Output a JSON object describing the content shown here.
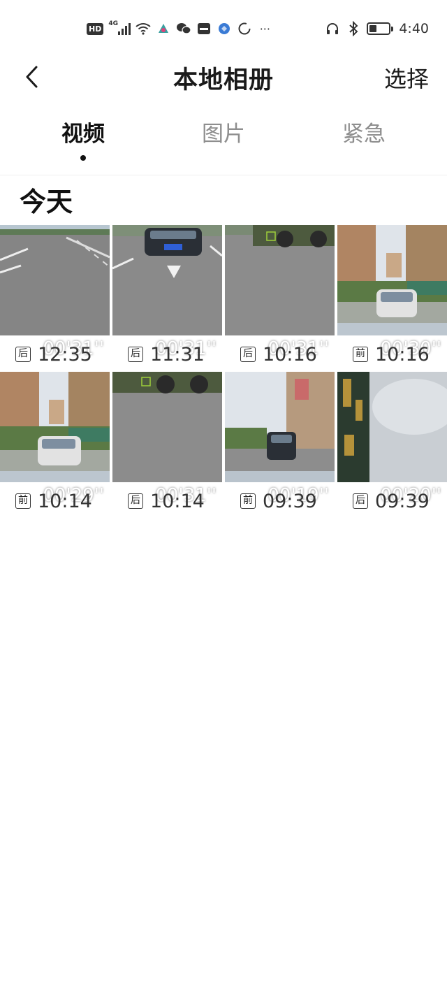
{
  "status_bar": {
    "hd_badge": "HD",
    "network": "4G",
    "time": "4:40",
    "battery_level": 0.4,
    "icons": [
      "hd-icon",
      "signal-icon",
      "wifi-icon",
      "app-icon",
      "wechat-icon",
      "huawei-icon",
      "browser-icon",
      "circle-icon",
      "more-dots-icon",
      "headphones-icon",
      "bluetooth-icon",
      "battery-icon"
    ],
    "more": "···"
  },
  "nav": {
    "title": "本地相册",
    "select_label": "选择"
  },
  "tabs": [
    {
      "label": "视频",
      "active": true
    },
    {
      "label": "图片",
      "active": false
    },
    {
      "label": "紧急",
      "active": false
    }
  ],
  "section": {
    "title": "今天"
  },
  "clips": [
    {
      "duration": "00'31''",
      "camera": "后",
      "time": "12:35",
      "scene": "road-wide"
    },
    {
      "duration": "00'31''",
      "camera": "后",
      "time": "11:31",
      "scene": "road-car-rear"
    },
    {
      "duration": "00'31''",
      "camera": "后",
      "time": "10:16",
      "scene": "road-truck"
    },
    {
      "duration": "00'30''",
      "camera": "前",
      "time": "10:16",
      "scene": "street-buildings-car"
    },
    {
      "duration": "00'29''",
      "camera": "前",
      "time": "10:14",
      "scene": "street-buildings-car"
    },
    {
      "duration": "00'31''",
      "camera": "后",
      "time": "10:14",
      "scene": "road-truck"
    },
    {
      "duration": "00'19''",
      "camera": "前",
      "time": "09:39",
      "scene": "street-shops-car"
    },
    {
      "duration": "00'20''",
      "camera": "后",
      "time": "09:39",
      "scene": "building-sky"
    }
  ]
}
